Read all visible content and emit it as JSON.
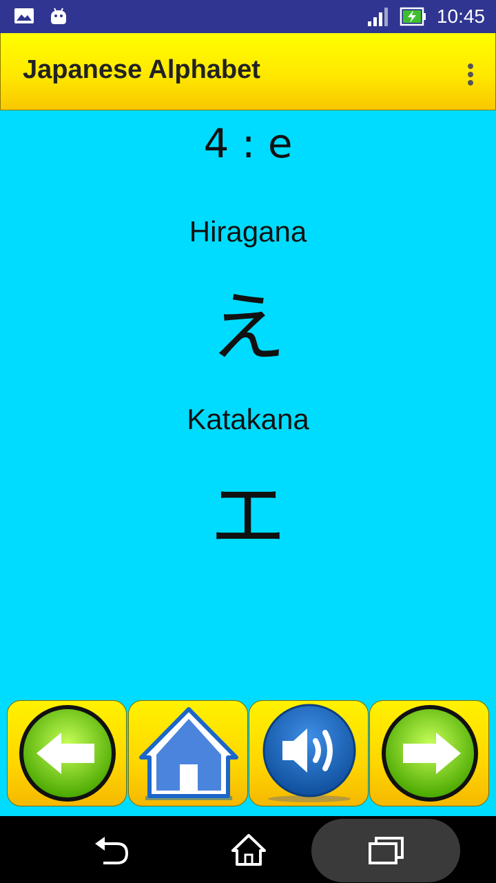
{
  "status_bar": {
    "time": "10:45",
    "icons": [
      "image-icon",
      "android-icon",
      "signal-icon",
      "battery-charging-icon"
    ]
  },
  "app_bar": {
    "title": "Japanese Alphabet",
    "menu_icon": "overflow-menu-icon"
  },
  "content": {
    "number_label": "4 : e",
    "hiragana_label": "Hiragana",
    "hiragana_char": "え",
    "katakana_label": "Katakana",
    "katakana_char": "エ"
  },
  "buttons": [
    "previous-arrow-icon",
    "home-icon",
    "speaker-icon",
    "next-arrow-icon"
  ],
  "colors": {
    "background": "#00dcff",
    "appbar": "#ffe800",
    "statusbar": "#2f3590",
    "button": "#ffd600"
  }
}
